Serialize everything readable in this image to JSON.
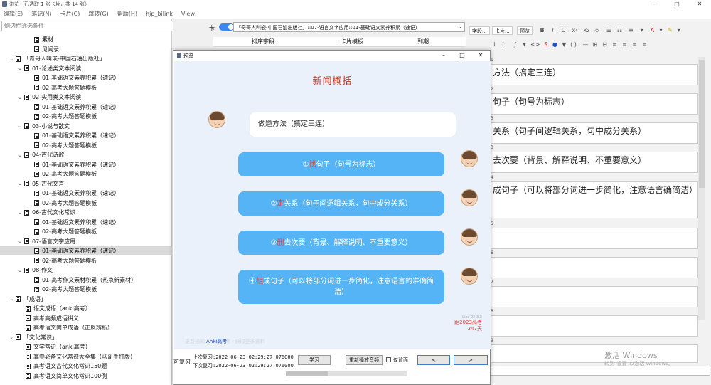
{
  "window": {
    "title": "浏览（已选取 1 张卡片，共 14 张）",
    "controls": [
      "–",
      "□",
      "✕"
    ]
  },
  "menu": [
    "编辑(E)",
    "笔记(N)",
    "卡片(C)",
    "跳转(G)",
    "帮助(H)",
    "hjp_bilink",
    "View"
  ],
  "sidebar": {
    "search_placeholder": "侧边栏筛选条件",
    "tree": [
      {
        "label": "素材",
        "level": 3,
        "arrow": false
      },
      {
        "label": "见闻录",
        "level": 3,
        "arrow": false
      },
      {
        "label": "「奇哥人叫嵌-中国石油出版社」",
        "level": 1,
        "arrow": true
      },
      {
        "label": "01-论述类文本阅读",
        "level": 2,
        "arrow": true
      },
      {
        "label": "01-基础语文素养积累（速记）",
        "level": 3,
        "arrow": false
      },
      {
        "label": "02-高考大题答题模板",
        "level": 3,
        "arrow": false
      },
      {
        "label": "02-实用类文本阅读",
        "level": 2,
        "arrow": true
      },
      {
        "label": "01-基础语文素养积累（速记）",
        "level": 3,
        "arrow": false
      },
      {
        "label": "02-高考大题答题模板",
        "level": 3,
        "arrow": false
      },
      {
        "label": "03-小说与散文",
        "level": 2,
        "arrow": true
      },
      {
        "label": "01-基础语文素养积累（速记）",
        "level": 3,
        "arrow": false
      },
      {
        "label": "02-高考大题答题模板",
        "level": 3,
        "arrow": false
      },
      {
        "label": "04-古代诗歌",
        "level": 2,
        "arrow": true
      },
      {
        "label": "01-基础语文素养积累（速记）",
        "level": 3,
        "arrow": false
      },
      {
        "label": "02-高考大题答题模板",
        "level": 3,
        "arrow": false
      },
      {
        "label": "05-古代文言",
        "level": 2,
        "arrow": true
      },
      {
        "label": "01-基础语文素养积累（速记）",
        "level": 3,
        "arrow": false
      },
      {
        "label": "02-高考大题答题模板",
        "level": 3,
        "arrow": false
      },
      {
        "label": "06-古代文化常识",
        "level": 2,
        "arrow": true
      },
      {
        "label": "01-基础语文素养积累（速记）",
        "level": 3,
        "arrow": false
      },
      {
        "label": "02-高考大题答题模板",
        "level": 3,
        "arrow": false
      },
      {
        "label": "07-语言文字应用",
        "level": 2,
        "arrow": true
      },
      {
        "label": "01-基础语文素养积累（速记）",
        "level": 3,
        "arrow": false,
        "selected": true
      },
      {
        "label": "02-高考大题答题模板",
        "level": 3,
        "arrow": false
      },
      {
        "label": "08-作文",
        "level": 2,
        "arrow": true
      },
      {
        "label": "01-高考作文素材积累（热点新素材）",
        "level": 3,
        "arrow": false
      },
      {
        "label": "02-高考大题答题模板",
        "level": 3,
        "arrow": false
      },
      {
        "label": "「成语」",
        "level": 1,
        "arrow": true
      },
      {
        "label": "语文成语（anki高考）",
        "level": 2,
        "arrow": false
      },
      {
        "label": "高考高频成语讲义",
        "level": 2,
        "arrow": false
      },
      {
        "label": "高考语文简单成语（正反辨析）",
        "level": 2,
        "arrow": false
      },
      {
        "label": "「文化常识」",
        "level": 1,
        "arrow": true
      },
      {
        "label": "文学常识（anki高考）",
        "level": 2,
        "arrow": false
      },
      {
        "label": "高中必备文化常识大全集（马哥手打版）",
        "level": 2,
        "arrow": false
      },
      {
        "label": "高考语文古代文化常识150题",
        "level": 2,
        "arrow": false
      },
      {
        "label": "高考语文简单文化常识100例",
        "level": 2,
        "arrow": false
      }
    ]
  },
  "browser": {
    "toggle_label": "卡",
    "deck_select": "「奇哥人叫嵌-中国石油出版社」::07-语言文字应用::01-基础语文素养积累（速记）",
    "columns": [
      "排序字段",
      "卡片模板",
      "到期"
    ]
  },
  "editor": {
    "tabs": [
      "字段...",
      "卡片...",
      "预览"
    ],
    "fields": [
      {
        "num": "1",
        "text": "方法（搞定三连）"
      },
      {
        "num": "2",
        "text": "句子（句号为标志）"
      },
      {
        "num": "3",
        "text": "关系（句子间逻辑关系，句中成分关系）"
      },
      {
        "num": "3",
        "text": "去次要（背景、解释说明、不重要意义）"
      },
      {
        "num": "4",
        "text": "成句子（可以将部分词进一步简化，注意语言确简洁）"
      },
      {
        "num": "5",
        "text": ""
      },
      {
        "num": "6",
        "text": ""
      },
      {
        "num": "7",
        "text": ""
      },
      {
        "num": "8",
        "text": ""
      },
      {
        "num": "9",
        "text": ""
      }
    ],
    "tag_label": "标签",
    "win_activate": "激活 Windows",
    "win_activate_sub": "转到“设置”以激活 Windows。"
  },
  "preview": {
    "title": "预览",
    "card_title": "新闻概括",
    "method": "做题方法（搞定三连）",
    "steps": [
      {
        "num": "①",
        "key": "找",
        "rest": "句子（句号为标志）"
      },
      {
        "num": "②",
        "key": "定",
        "rest": "关系（句子间逻辑关系，句中成分关系）"
      },
      {
        "num": "③",
        "key": "删",
        "rest": "去次要（背景、解释说明、不重要意义）"
      },
      {
        "num": "④",
        "key": "组",
        "rest": "成句子（可以将部分词进一步简化，注意语言的准确简洁）"
      }
    ],
    "version": "Liee 22.3.3",
    "exam_line1": "距2023高考",
    "exam_line2": "347天",
    "anki_link": "Anki高考",
    "faint_text": "更新通知 · Anki高考 · 获取更多资料",
    "review_label": "可复习",
    "last_review": "上次复习:2022-06-23 02:29:27.076000",
    "next_review": "下次复习:2022-06-23 02:29:27.076000",
    "btn_study": "学习",
    "btn_replay": "重新播放音频",
    "back_only": "仅背面",
    "prev": "<",
    "next": ">"
  }
}
